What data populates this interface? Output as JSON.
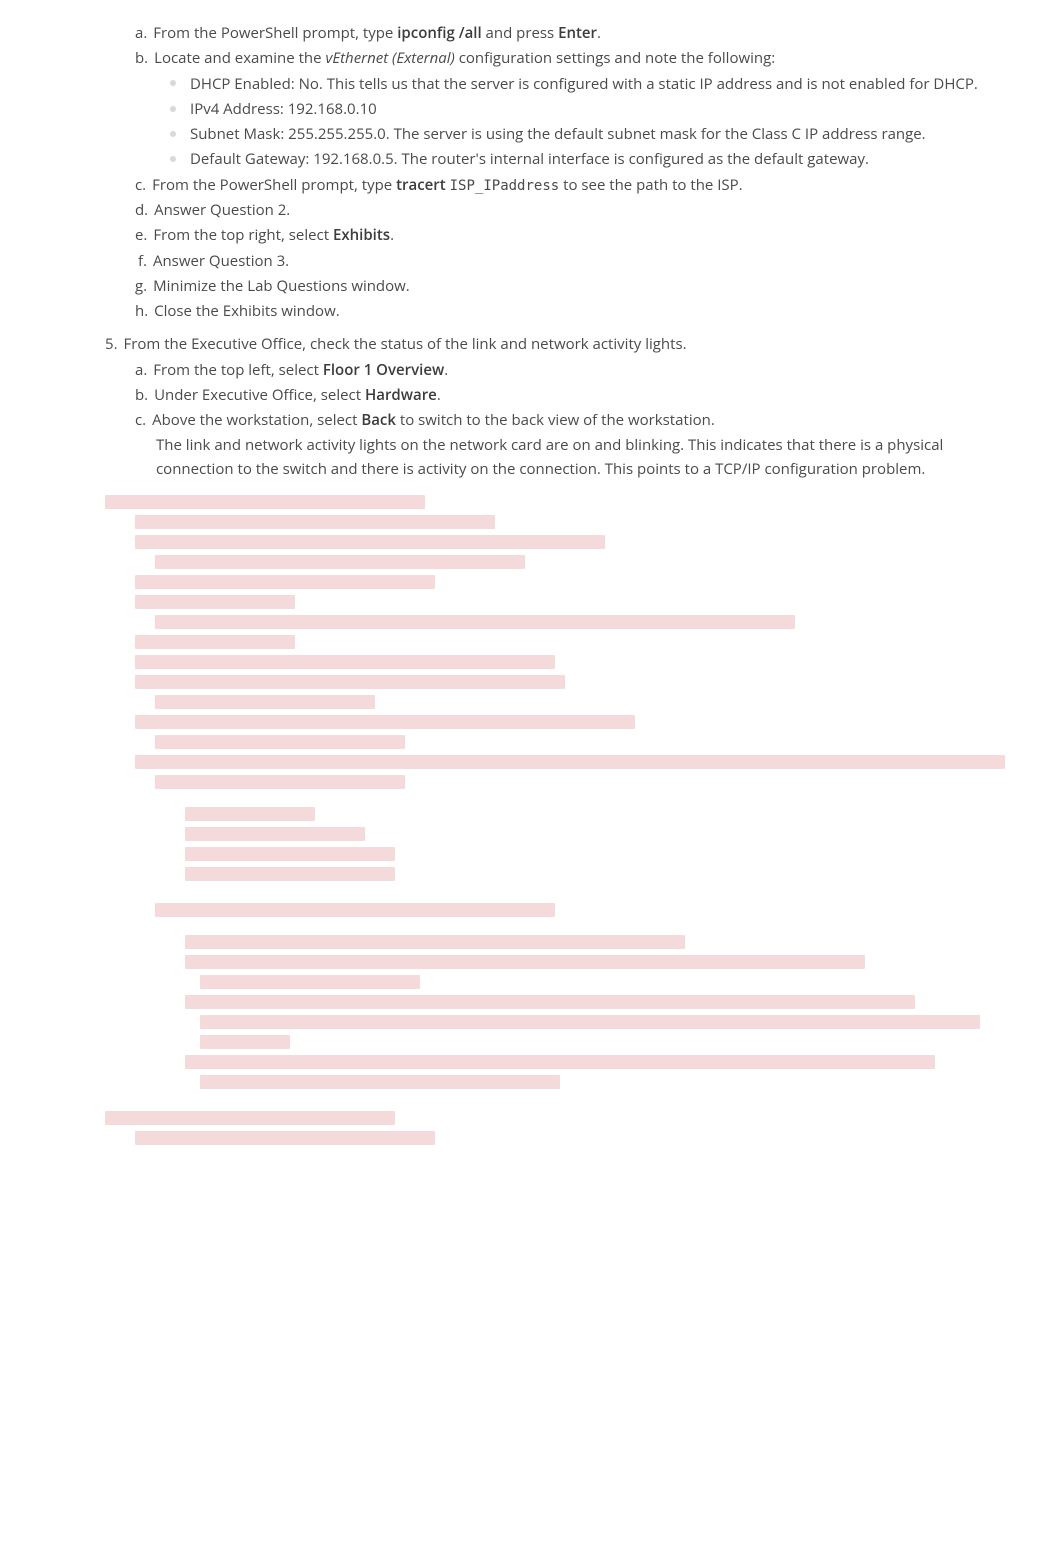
{
  "sub_a": {
    "marker": "a.",
    "text_before": "From the PowerShell prompt, type ",
    "cmd": "ipconfig /all",
    "text_mid": " and press ",
    "key": "Enter",
    "text_after": "."
  },
  "sub_b": {
    "marker": "b.",
    "text_before": "Locate and examine the ",
    "em": "vEthernet (External)",
    "text_after": " configuration settings and note the following:"
  },
  "b_bullets": [
    "DHCP Enabled: No. This tells us that the server is configured with a static IP address and is not enabled for DHCP.",
    "IPv4 Address: 192.168.0.10",
    "Subnet Mask: 255.255.255.0. The server is using the default subnet mask for the Class C IP address range.",
    "Default Gateway: 192.168.0.5. The router's internal interface is configured as the default gateway."
  ],
  "sub_c": {
    "marker": "c.",
    "text_before": "From the PowerShell prompt, type ",
    "cmd": "tracert",
    "arg": "ISP_IPaddress",
    "text_after": " to see the path to the ISP."
  },
  "sub_d": {
    "marker": "d.",
    "text": "Answer Question 2."
  },
  "sub_e": {
    "marker": "e.",
    "text_before": "From the top right, select ",
    "bold": "Exhibits",
    "text_after": "."
  },
  "sub_f": {
    "marker": "f.",
    "text": "Answer Question 3."
  },
  "sub_g": {
    "marker": "g.",
    "text": "Minimize the Lab Questions window."
  },
  "sub_h": {
    "marker": "h.",
    "text": "Close the Exhibits window."
  },
  "step5": {
    "marker": "5.",
    "text": "From the Executive Office, check the status of the link and network activity lights."
  },
  "s5a": {
    "marker": "a.",
    "text_before": "From the top left, select ",
    "bold": "Floor 1 Overview",
    "text_after": "."
  },
  "s5b": {
    "marker": "b.",
    "text_before": "Under Executive Office, select ",
    "bold": "Hardware",
    "text_after": "."
  },
  "s5c": {
    "marker": "c.",
    "text_before": "Above the workstation, select ",
    "bold": "Back",
    "text_after": " to switch to the back view of the workstation."
  },
  "s5c_note": "The link and network activity lights on the network card are on and blinking. This indicates that there is a physical connection to the switch and there is activity on the connection. This points to a TCP/IP configuration problem."
}
